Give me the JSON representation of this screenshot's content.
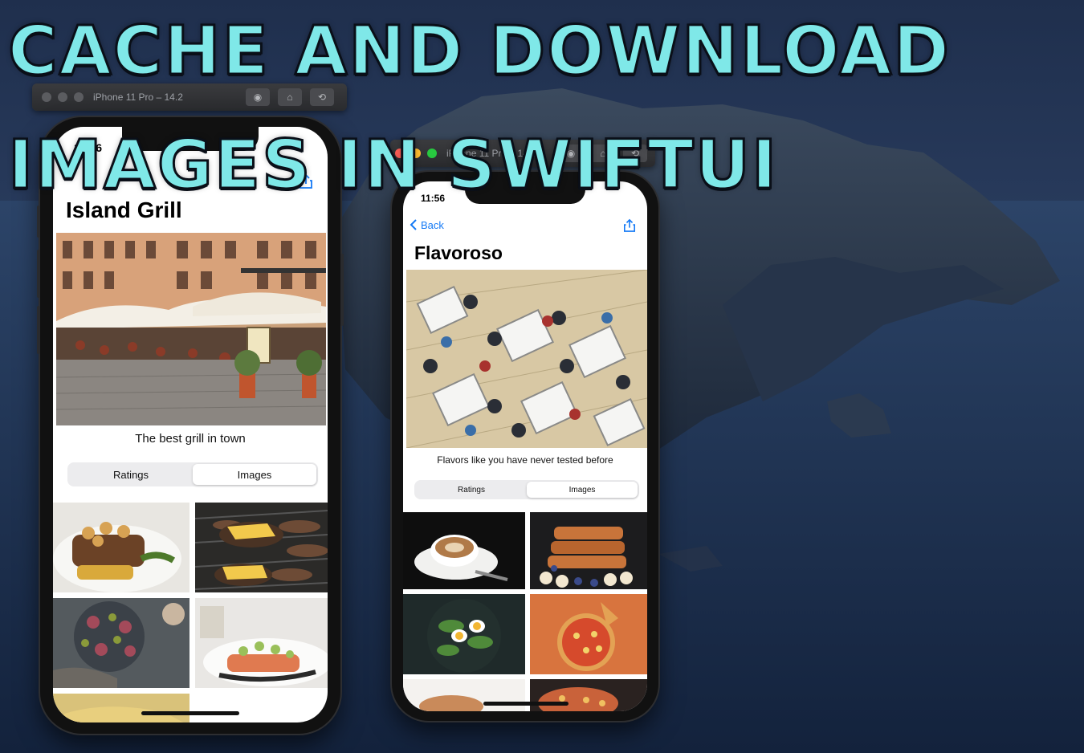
{
  "headline": {
    "line1": "CACHE AND DOWNLOAD",
    "line2": "IMAGES IN SWIFTUI"
  },
  "simulator_left": {
    "window_title": "iPhone 11 Pro – 14.2",
    "status_time": "11:56",
    "restaurant_name": "Island Grill",
    "description": "The best grill in town",
    "segments": [
      "Ratings",
      "Images"
    ],
    "selected_segment": "Images"
  },
  "simulator_right": {
    "window_title": "iPhone 11 Pro – 14.2",
    "status_time": "11:56",
    "back_label": "Back",
    "restaurant_name": "Flavoroso",
    "description": "Flavors like you have never tested before",
    "segments": [
      "Ratings",
      "Images"
    ],
    "selected_segment": "Images"
  },
  "icons": {
    "back": "chevron-left-icon",
    "share": "share-icon",
    "screenshot": "camera-icon",
    "home": "home-icon",
    "rotate": "rotate-icon"
  },
  "colors": {
    "accent": "#1479f5",
    "headline": "#7fe8e8",
    "window_close": "#ff5f57",
    "window_min": "#febc2e",
    "window_max": "#28c840"
  }
}
